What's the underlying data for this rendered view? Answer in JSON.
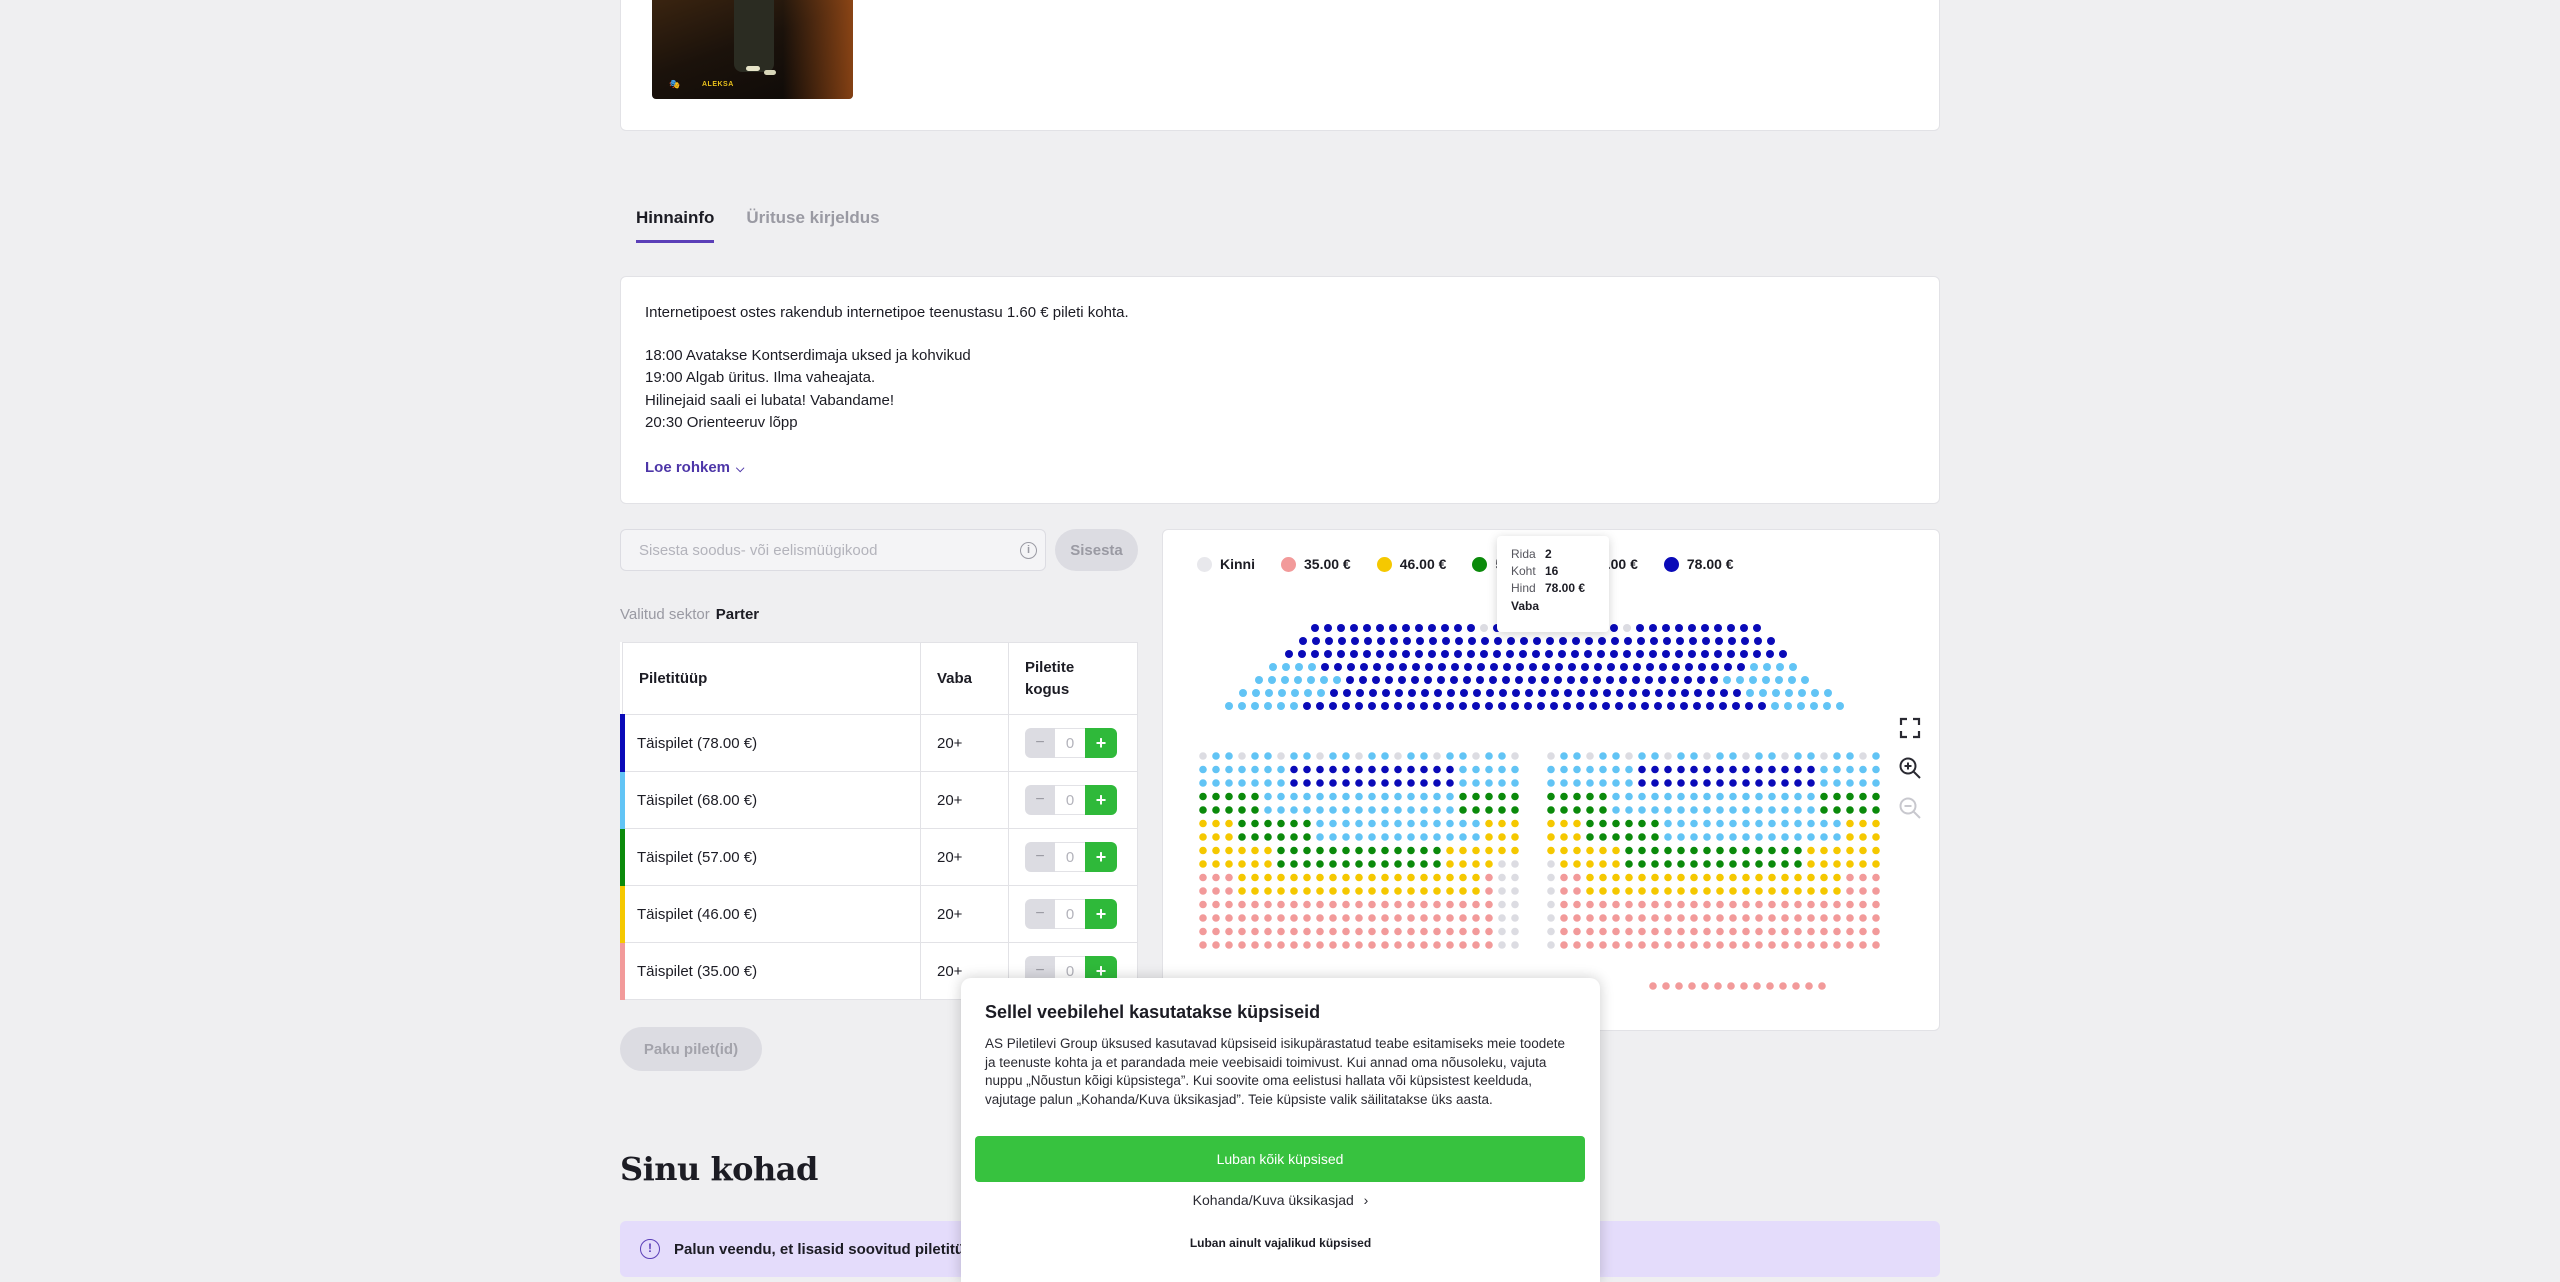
{
  "poster": {
    "logo_left": "🎭",
    "logo_right": "ALEKSA"
  },
  "tabs": [
    {
      "label": "Hinnainfo",
      "active": true
    },
    {
      "label": "Ürituse kirjeldus",
      "active": false
    }
  ],
  "info": {
    "service_fee": "Internetipoest ostes rakendub internetipoe teenustasu 1.60 € pileti kohta.",
    "lines": [
      "18:00 Avatakse Kontserdimaja uksed ja kohvikud",
      "19:00 Algab üritus. Ilma vaheajata.",
      "Hilinejaid saali ei lubata! Vabandame!",
      "20:30 Orienteeruv lõpp"
    ],
    "read_more": "Loe rohkem"
  },
  "promo": {
    "placeholder": "Sisesta soodus- või eelismüügikood",
    "button": "Sisesta"
  },
  "sector": {
    "label": "Valitud sektor",
    "value": "Parter"
  },
  "ticket_table": {
    "headers": [
      "Piletitüüp",
      "Vaba",
      "Piletite kogus"
    ],
    "rows": [
      {
        "type": "Täispilet (78.00 €)",
        "available": "20+",
        "qty": "0",
        "color": "#0a0ab8"
      },
      {
        "type": "Täispilet (68.00 €)",
        "available": "20+",
        "qty": "0",
        "color": "#62c4f5"
      },
      {
        "type": "Täispilet (57.00 €)",
        "available": "20+",
        "qty": "0",
        "color": "#0b8a0b"
      },
      {
        "type": "Täispilet (46.00 €)",
        "available": "20+",
        "qty": "0",
        "color": "#f5c800"
      },
      {
        "type": "Täispilet (35.00 €)",
        "available": "20+",
        "qty": "0",
        "color": "#f29a9a"
      }
    ],
    "minus": "−",
    "plus": "+"
  },
  "buy_button": "Paku pilet(id)",
  "your_seats": {
    "title": "Sinu kohad",
    "notice": "Palun veendu, et lisasid soovitud piletitüübid"
  },
  "seat_map": {
    "legend": [
      {
        "label": "Kinni",
        "color": "#e8e8ec"
      },
      {
        "label": "35.00 €",
        "color": "#f29a9a"
      },
      {
        "label": "46.00 €",
        "color": "#f5c800"
      },
      {
        "label": "57.00 €",
        "color": "#0b8a0b"
      },
      {
        "label": "68.00 €",
        "color": "#62c4f5"
      },
      {
        "label": "78.00 €",
        "color": "#0a0ab8"
      }
    ],
    "tooltip": {
      "row_label": "Rida",
      "row_value": "2",
      "seat_label": "Koht",
      "seat_value": "16",
      "price_label": "Hind",
      "price_value": "78.00 €",
      "status": "Vaba"
    }
  },
  "cookie": {
    "title": "Sellel veebilehel kasutatakse küpsiseid",
    "body": "AS Piletilevi Group üksused kasutavad küpsiseid isikupärastatud teabe esitamiseks meie toodete ja teenuste kohta ja et parandada meie veebisaidi toimivust. Kui annad oma nõusoleku, vajuta nuppu „Nõustun kõigi küpsistega”. Kui soovite oma eelistusi hallata või küpsistest keelduda, vajutage palun „Kohanda/Kuva üksikasjad”. Teie küpsiste valik säilitatakse üks aasta.",
    "accept": "Luban kõik küpsised",
    "customize": "Kohanda/Kuva üksikasjad",
    "customize_chevron": "›",
    "essential": "Luban ainult vajalikud küpsised"
  }
}
